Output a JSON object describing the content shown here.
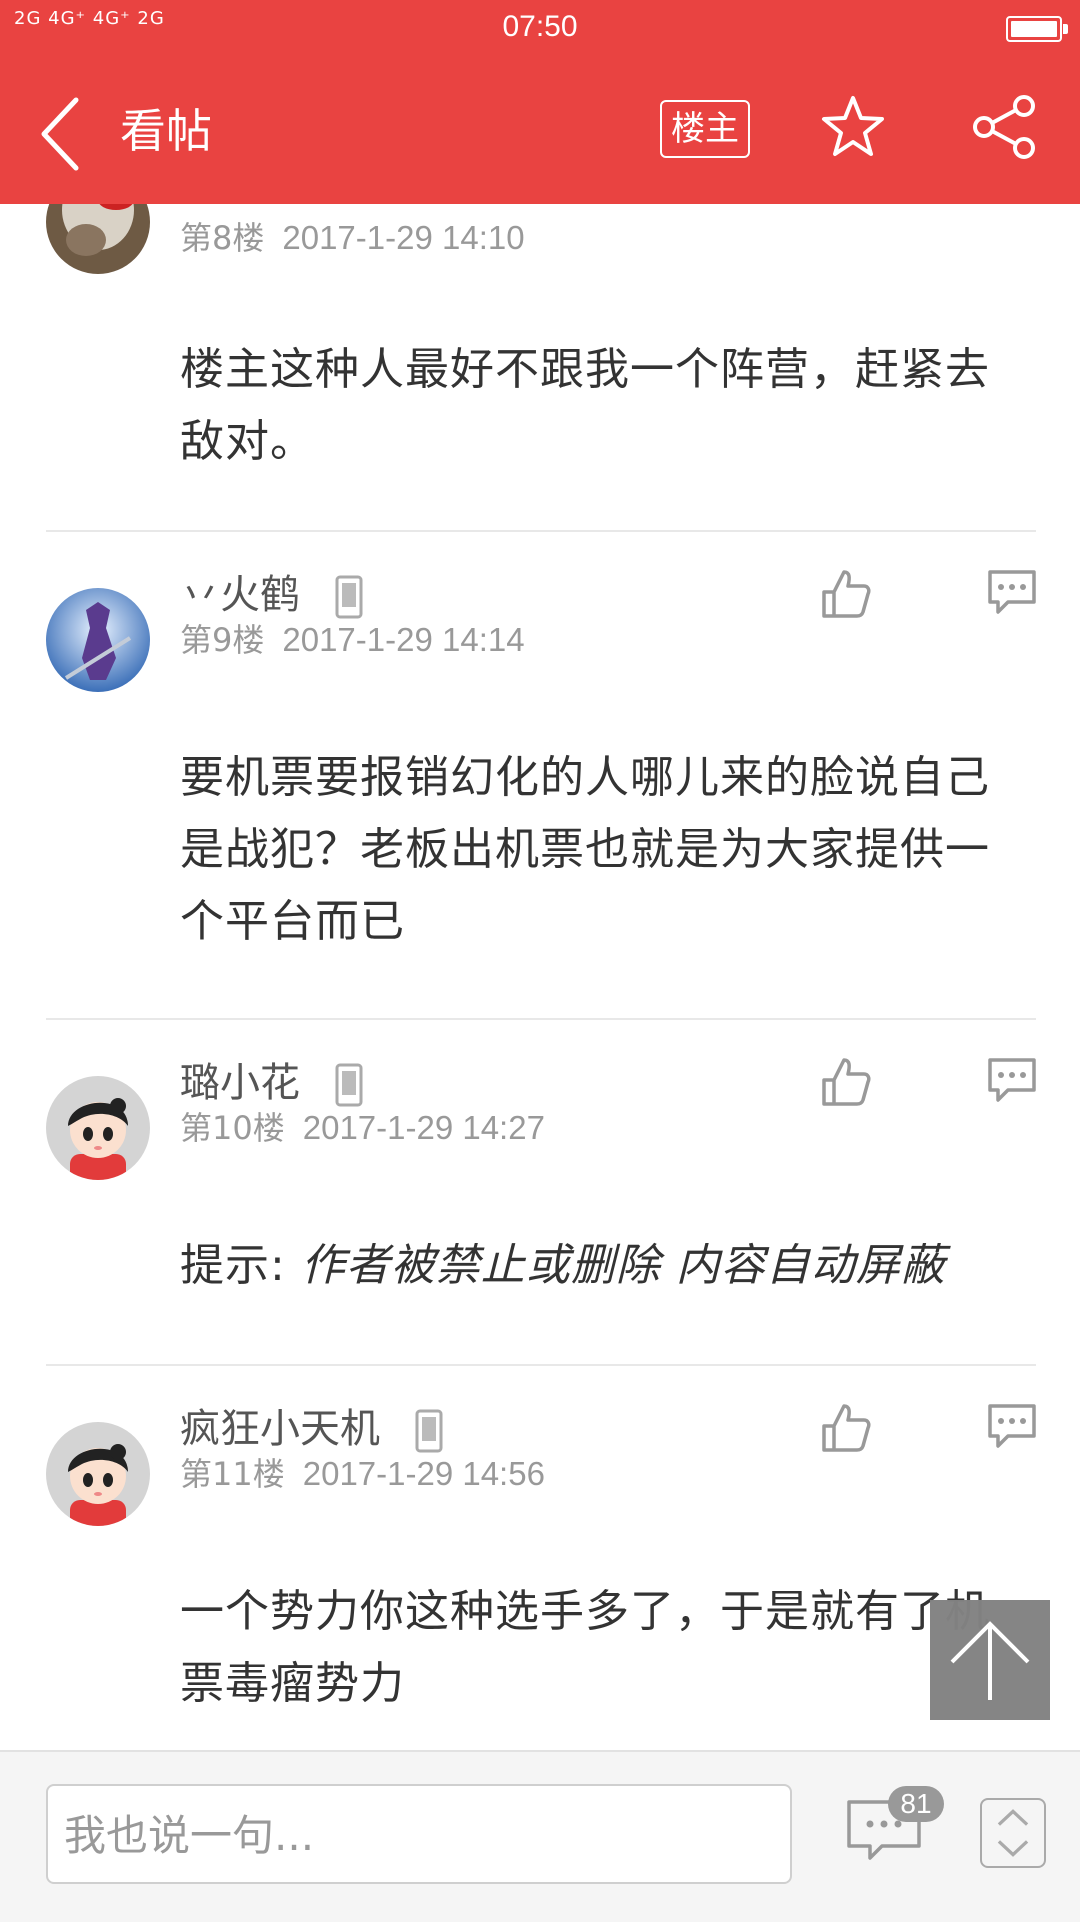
{
  "status_bar": {
    "signal_text": "2G 4G⁺ 4G⁺ 2G",
    "time": "07:50"
  },
  "nav": {
    "title": "看帖",
    "owner_only_label": "楼主"
  },
  "posts": [
    {
      "username": "",
      "floor": "第8楼",
      "timestamp": "2017-1-29 14:10",
      "content": "楼主这种人最好不跟我一个阵营，赶紧去敌对。"
    },
    {
      "username": "丷火鹤",
      "floor": "第9楼",
      "timestamp": "2017-1-29 14:14",
      "content": "要机票要报销幻化的人哪儿来的脸说自己是战犯？老板出机票也就是为大家提供一个平台而已"
    },
    {
      "username": "璐小花",
      "floor": "第10楼",
      "timestamp": "2017-1-29 14:27",
      "hint_label": "提示: ",
      "hint_body": "作者被禁止或删除 内容自动屏蔽"
    },
    {
      "username": "疯狂小天机",
      "floor": "第11楼",
      "timestamp": "2017-1-29 14:56",
      "content": "一个势力你这种选手多了，于是就有了机票毒瘤势力"
    }
  ],
  "bottom_bar": {
    "input_placeholder": "我也说一句...",
    "comment_count": "81"
  },
  "colors": {
    "header_red": "#e94341",
    "text_dark": "#333333",
    "text_meta": "#999999"
  },
  "icons": [
    "back-arrow-icon",
    "star-icon",
    "share-icon",
    "thumbs-up-icon",
    "reply-icon",
    "phone-icon",
    "comment-icon",
    "back-to-top-icon",
    "page-up-down-icon"
  ]
}
